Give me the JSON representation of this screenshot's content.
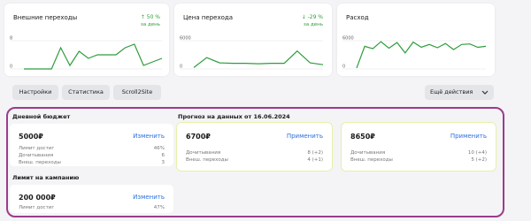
{
  "metrics": [
    {
      "title": "Внешние переходы",
      "delta": "↑ 50 %",
      "period": "за день",
      "axis_top": "8",
      "axis_bottom": "0",
      "series": [
        0,
        0,
        0,
        0,
        6,
        1,
        5,
        3,
        4,
        4,
        4,
        6,
        7,
        1,
        2,
        3
      ]
    },
    {
      "title": "Цена перехода",
      "delta": "↓ -29 %",
      "period": "за день",
      "axis_top": "6000",
      "axis_bottom": "0",
      "series": [
        300,
        2400,
        1300,
        1200,
        1200,
        1100,
        1200,
        1200,
        3800,
        1300,
        900
      ]
    },
    {
      "title": "Расход",
      "delta": "",
      "period": "",
      "axis_top": "6000",
      "axis_bottom": "0",
      "series": [
        200,
        4800,
        4300,
        5800,
        4400,
        5600,
        3400,
        5700,
        4600,
        5200,
        4500,
        5400,
        4100,
        5200,
        5300,
        4600,
        4800
      ]
    }
  ],
  "toolbar": {
    "settings": "Настройки",
    "stats": "Статистика",
    "scroll2site": "Scroll2Site",
    "more": "Ещё действия"
  },
  "budget": {
    "daily_title": "Дневной бюджет",
    "daily_amount": "5000₽",
    "change": "Изменить",
    "limit_reached_label": "Лимит достиг",
    "limit_reached_value": "46%",
    "reads_label": "Дочитывания",
    "reads_value": "6",
    "ext_label": "Внеш. переходы",
    "ext_value": "3",
    "campaign_title": "Лимит на кампанию",
    "campaign_amount": "200 000₽",
    "campaign_limit_label": "Лимит достиг",
    "campaign_limit_value": "47%"
  },
  "forecast": {
    "title": "Прогноз на данных от 16.06.2024",
    "apply": "Применить",
    "options": [
      {
        "amount": "6700₽",
        "reads_label": "Дочитывания",
        "reads_value": "8 (+2)",
        "ext_label": "Внеш. переходы",
        "ext_value": "4 (+1)"
      },
      {
        "amount": "8650₽",
        "reads_label": "Дочитывания",
        "reads_value": "10 (+4)",
        "ext_label": "Внеш. переходы",
        "ext_value": "5 (+2)"
      }
    ]
  },
  "colors": {
    "line": "#2e9d3d",
    "link": "#2b6fe0",
    "highlight": "#9c3b8d",
    "forecast_border": "#e6f0a8"
  }
}
